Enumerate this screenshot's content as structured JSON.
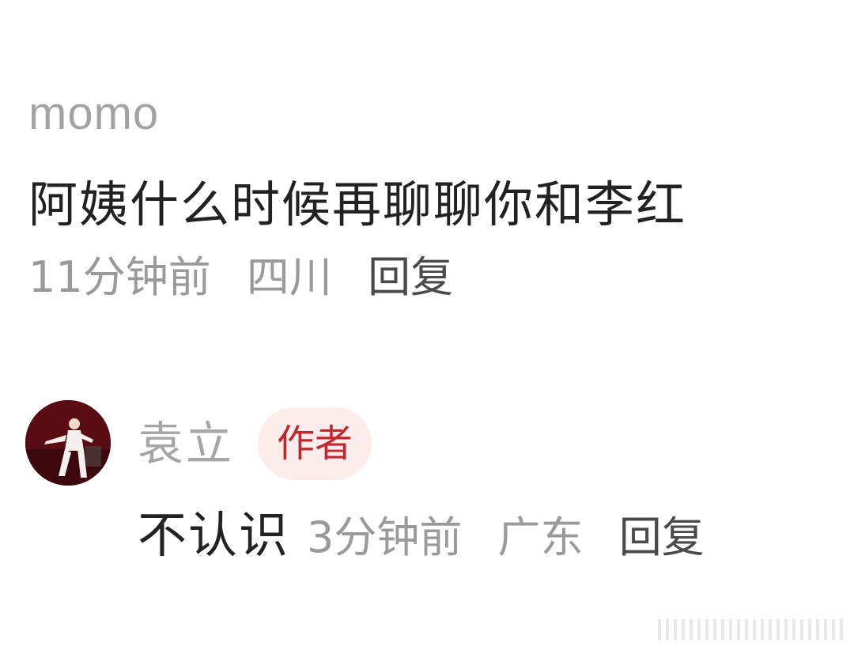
{
  "comment": {
    "username": "momo",
    "text": "阿姨什么时候再聊聊你和李红",
    "time": "11分钟前",
    "location": "四川",
    "reply_label": "回复"
  },
  "reply": {
    "avatar_icon": "user-avatar-icon",
    "username": "袁立",
    "badge": "作者",
    "text": "不认识",
    "time": "3分钟前",
    "location": "广东",
    "reply_label": "回复"
  },
  "colors": {
    "username": "#a3a3a3",
    "text": "#222222",
    "meta": "#9a9a9a",
    "badge_bg": "#fdecec",
    "badge_text": "#c0282f"
  }
}
